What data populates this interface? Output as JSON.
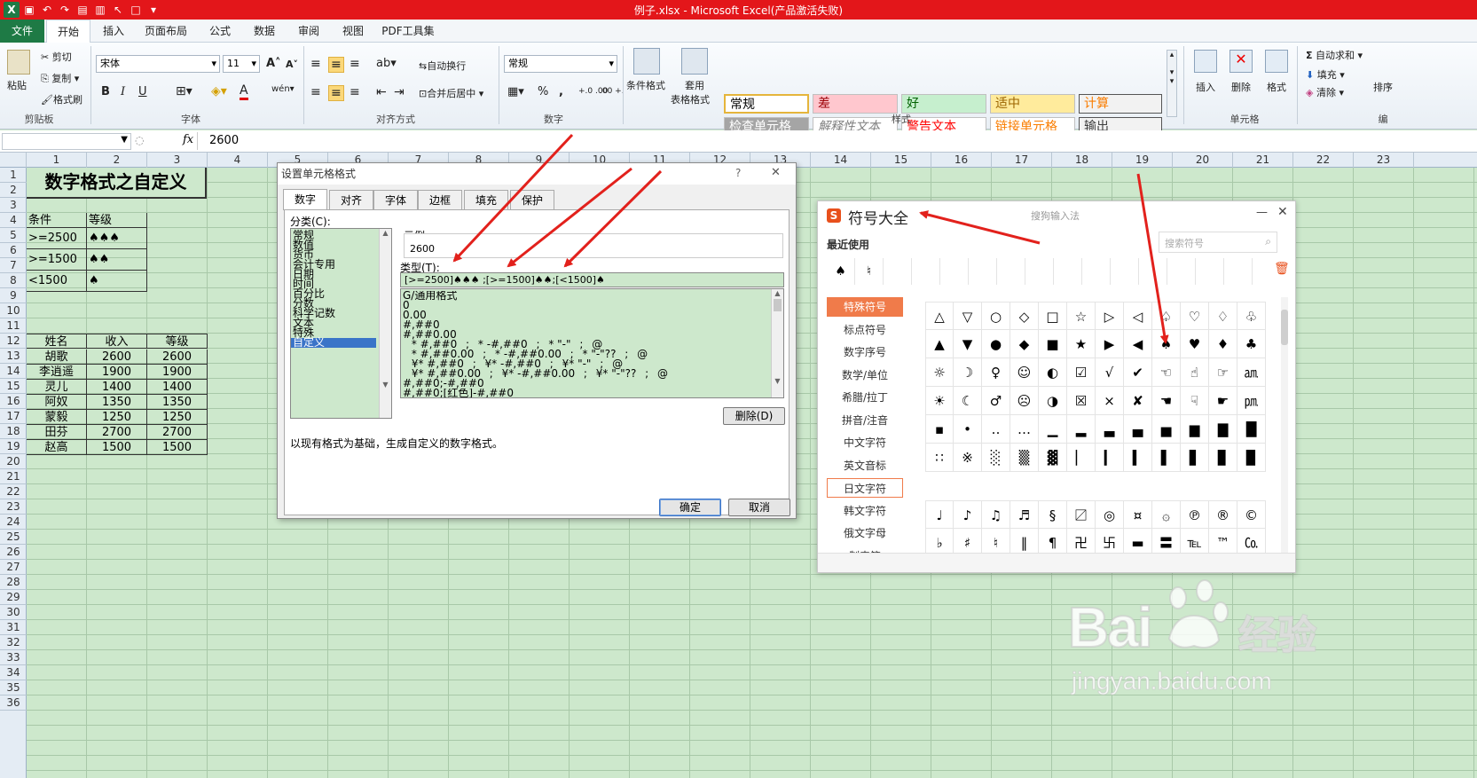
{
  "window": {
    "title": "例子.xlsx - Microsoft Excel(产品激活失败)"
  },
  "menu": {
    "file": "文件",
    "tabs": [
      "开始",
      "插入",
      "页面布局",
      "公式",
      "数据",
      "审阅",
      "视图",
      "PDF工具集"
    ]
  },
  "ribbon": {
    "clipboard": {
      "paste": "粘贴",
      "cut": "剪切",
      "copy": "复制",
      "format_painter": "格式刷",
      "label": "剪贴板"
    },
    "font": {
      "name": "宋体",
      "size": "11",
      "label": "字体",
      "bold": "B",
      "italic": "I",
      "underline": "U",
      "grow": "A˄",
      "shrink": "A˅"
    },
    "alignment": {
      "wrap": "自动换行",
      "merge": "合并后居中",
      "label": "对齐方式"
    },
    "number": {
      "format": "常规",
      "label": "数字",
      "percent": "%",
      "comma": ",",
      "inc": "+.0 .00",
      "dec": ".00 +.0"
    },
    "styles": {
      "cond_format": "条件格式",
      "table_format_1": "套用",
      "table_format_2": "表格格式",
      "cells": [
        {
          "label": "常规",
          "bg": "#ffffff",
          "color": "#000000"
        },
        {
          "label": "差",
          "bg": "#ffc7ce",
          "color": "#9c0006"
        },
        {
          "label": "好",
          "bg": "#c6efce",
          "color": "#006100"
        },
        {
          "label": "适中",
          "bg": "#ffeb9c",
          "color": "#9c6500"
        },
        {
          "label": "计算",
          "bg": "#f2f2f2",
          "color": "#fa7d00"
        },
        {
          "label": "检查单元格",
          "bg": "#a5a5a5",
          "color": "#ffffff"
        },
        {
          "label": "解释性文本",
          "bg": "#ffffff",
          "color": "#7f7f7f"
        },
        {
          "label": "警告文本",
          "bg": "#ffffff",
          "color": "#ff0000"
        },
        {
          "label": "链接单元格",
          "bg": "#ffffff",
          "color": "#fa7d00"
        },
        {
          "label": "输出",
          "bg": "#f2f2f2",
          "color": "#3f3f3f"
        }
      ],
      "label": "样式"
    },
    "cells_group": {
      "insert": "插入",
      "delete": "删除",
      "format": "格式",
      "label": "单元格"
    },
    "editing": {
      "autosum": "自动求和",
      "fill": "填充",
      "clear": "清除",
      "sort": "排序",
      "label": "编"
    }
  },
  "formula_bar": {
    "fx": "fx",
    "value": "2600"
  },
  "grid": {
    "columns": [
      "1",
      "2",
      "3",
      "4",
      "5",
      "6",
      "7",
      "8",
      "9",
      "10",
      "11",
      "12",
      "13",
      "14",
      "15",
      "16",
      "17",
      "18",
      "19",
      "20",
      "21",
      "22",
      "23"
    ],
    "rows": [
      "1",
      "2",
      "3",
      "4",
      "5",
      "6",
      "7",
      "8",
      "9",
      "10",
      "11",
      "12",
      "13",
      "14",
      "15",
      "16",
      "17",
      "18",
      "19",
      "20",
      "21",
      "22",
      "23",
      "24",
      "25",
      "26",
      "27",
      "28",
      "29",
      "30",
      "31",
      "32",
      "33",
      "34",
      "35",
      "36"
    ]
  },
  "sheet": {
    "title": "数字格式之自定义",
    "cond_header": [
      "条件",
      "等级"
    ],
    "cond_rows": [
      [
        ">=2500",
        "♠♠♠"
      ],
      [
        ">=1500",
        "♠♠"
      ],
      [
        "<1500",
        "♠"
      ]
    ],
    "table_header": [
      "姓名",
      "收入",
      "等级"
    ],
    "table_rows": [
      [
        "胡歌",
        "2600",
        "2600"
      ],
      [
        "李逍遥",
        "1900",
        "1900"
      ],
      [
        "灵儿",
        "1400",
        "1400"
      ],
      [
        "阿奴",
        "1350",
        "1350"
      ],
      [
        "蒙毅",
        "1250",
        "1250"
      ],
      [
        "田芬",
        "2700",
        "2700"
      ],
      [
        "赵高",
        "1500",
        "1500"
      ]
    ]
  },
  "dialog": {
    "title": "设置单元格格式",
    "help": "?",
    "close": "✕",
    "tabs": [
      "数字",
      "对齐",
      "字体",
      "边框",
      "填充",
      "保护"
    ],
    "category_label": "分类(C):",
    "categories": [
      "常规",
      "数值",
      "货币",
      "会计专用",
      "日期",
      "时间",
      "百分比",
      "分数",
      "科学记数",
      "文本",
      "特殊",
      "自定义"
    ],
    "sample_label": "示例",
    "sample_value": "2600",
    "type_label": "类型(T):",
    "type_value": "[>=2500]♠♠♠ ;[>=1500]♠♠;[<1500]♠",
    "format_list": [
      "G/通用格式",
      "0",
      "0.00",
      "#,##0",
      "#,##0.00",
      "_ * #,##0_ ;_ * -#,##0_ ;_ * \"-\"_ ;_ @_",
      "_ * #,##0.00_ ;_ * -#,##0.00_ ;_ * \"-\"??_ ;_ @_",
      "_ ¥* #,##0_ ;_ ¥* -#,##0_ ;_ ¥* \"-\"_ ;_ @_",
      "_ ¥* #,##0.00_ ;_ ¥* -#,##0.00_ ;_ ¥* \"-\"??_ ;_ @_",
      "#,##0;-#,##0",
      "#,##0;[红色]-#,##0"
    ],
    "delete_btn": "删除(D)",
    "description": "以现有格式为基础，生成自定义的数字格式。",
    "ok": "确定",
    "cancel": "取消"
  },
  "symbol_panel": {
    "title": "符号大全",
    "source": "搜狗输入法",
    "minimize": "—",
    "close": "✕",
    "recent_label": "最近使用",
    "search_placeholder": "搜索符号",
    "recent": [
      "♠",
      "♮"
    ],
    "categories": [
      "特殊符号",
      "标点符号",
      "数字序号",
      "数学/单位",
      "希腊/拉丁",
      "拼音/注音",
      "中文字符",
      "英文音标",
      "日文字符",
      "韩文字符",
      "俄文字母",
      "制表符"
    ],
    "active_category": "特殊符号",
    "grid1": [
      [
        "△",
        "▽",
        "○",
        "◇",
        "□",
        "☆",
        "▷",
        "◁",
        "♤",
        "♡",
        "♢",
        "♧"
      ],
      [
        "▲",
        "▼",
        "●",
        "◆",
        "■",
        "★",
        "▶",
        "◀",
        "♠",
        "♥",
        "♦",
        "♣"
      ],
      [
        "☼",
        "☽",
        "♀",
        "☺",
        "◐",
        "☑",
        "√",
        "✔",
        "☜",
        "☝",
        "☞",
        "㏂"
      ],
      [
        "☀",
        "☾",
        "♂",
        "☹",
        "◑",
        "☒",
        "×",
        "✘",
        "☚",
        "☟",
        "☛",
        "㏘"
      ],
      [
        "▪",
        "•",
        "‥",
        "…",
        "▁",
        "▂",
        "▃",
        "▄",
        "▅",
        "▆",
        "▇",
        "█"
      ],
      [
        "∷",
        "※",
        "░",
        "▒",
        "▓",
        "▏",
        "▎",
        "▍",
        "▌",
        "▋",
        "▊",
        "▉"
      ]
    ],
    "grid2": [
      [
        "♩",
        "♪",
        "♫",
        "♬",
        "§",
        "〼",
        "◎",
        "¤",
        "۞",
        "℗",
        "®",
        "©"
      ],
      [
        "♭",
        "♯",
        "♮",
        "‖",
        "¶",
        "卍",
        "卐",
        "▬",
        "〓",
        "℡",
        "™",
        "㏇"
      ]
    ]
  },
  "watermark": {
    "brand": "Bai",
    "brand2": "经验",
    "url": "jingyan.baidu.com"
  }
}
